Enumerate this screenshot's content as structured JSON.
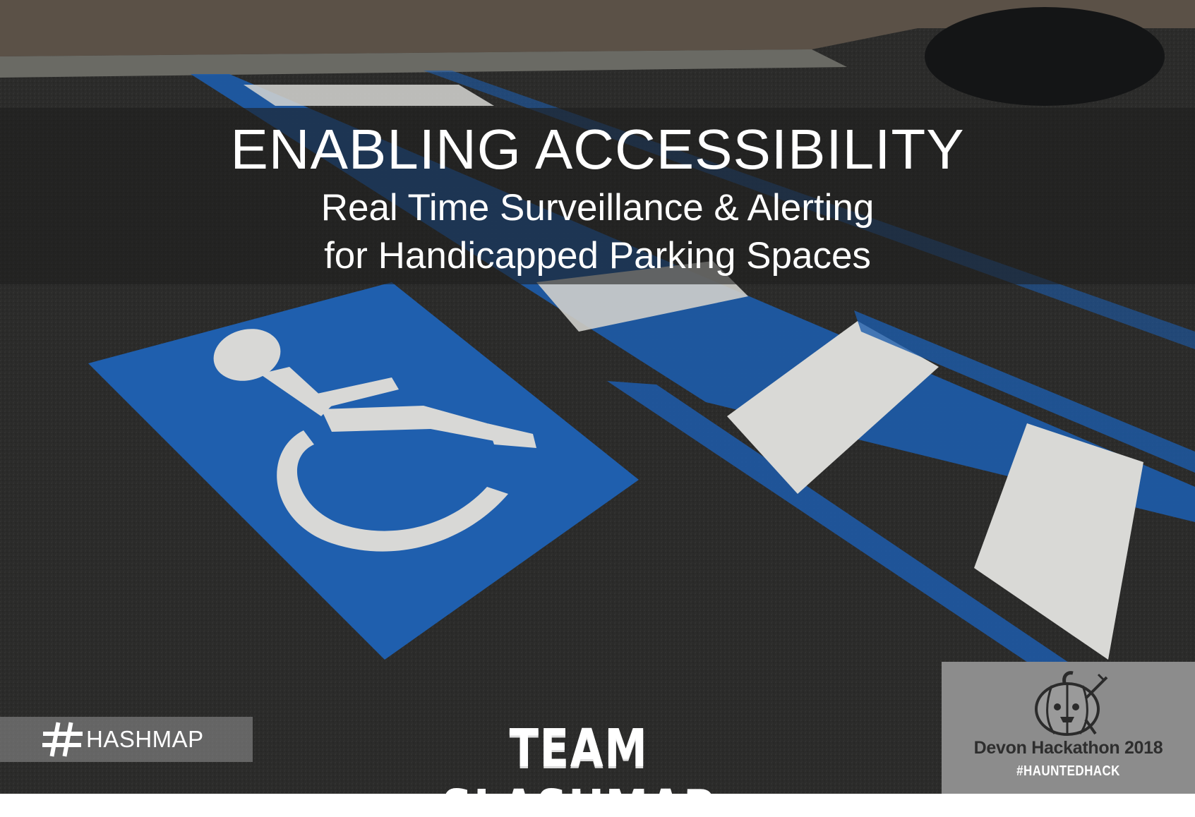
{
  "slide": {
    "title": "ENABLING ACCESSIBILITY",
    "subtitle_line_1": "Real Time Surveillance & Alerting",
    "subtitle_line_2": "for Handicapped Parking Spaces"
  },
  "sponsor_logo": {
    "text": "HASHMAP",
    "icon": "hash-icon"
  },
  "team": {
    "name": "TEAM SLASHMAP"
  },
  "event_badge": {
    "name": "Devon Hackathon 2018",
    "tag": "#HAUNTEDHACK",
    "icon": "pumpkin-icon"
  },
  "colors": {
    "asphalt": "#2a2a29",
    "accessibility_blue": "#1f5fae",
    "stripe_white": "#d9d9d6",
    "badge_gray": "#8c8c8c"
  }
}
